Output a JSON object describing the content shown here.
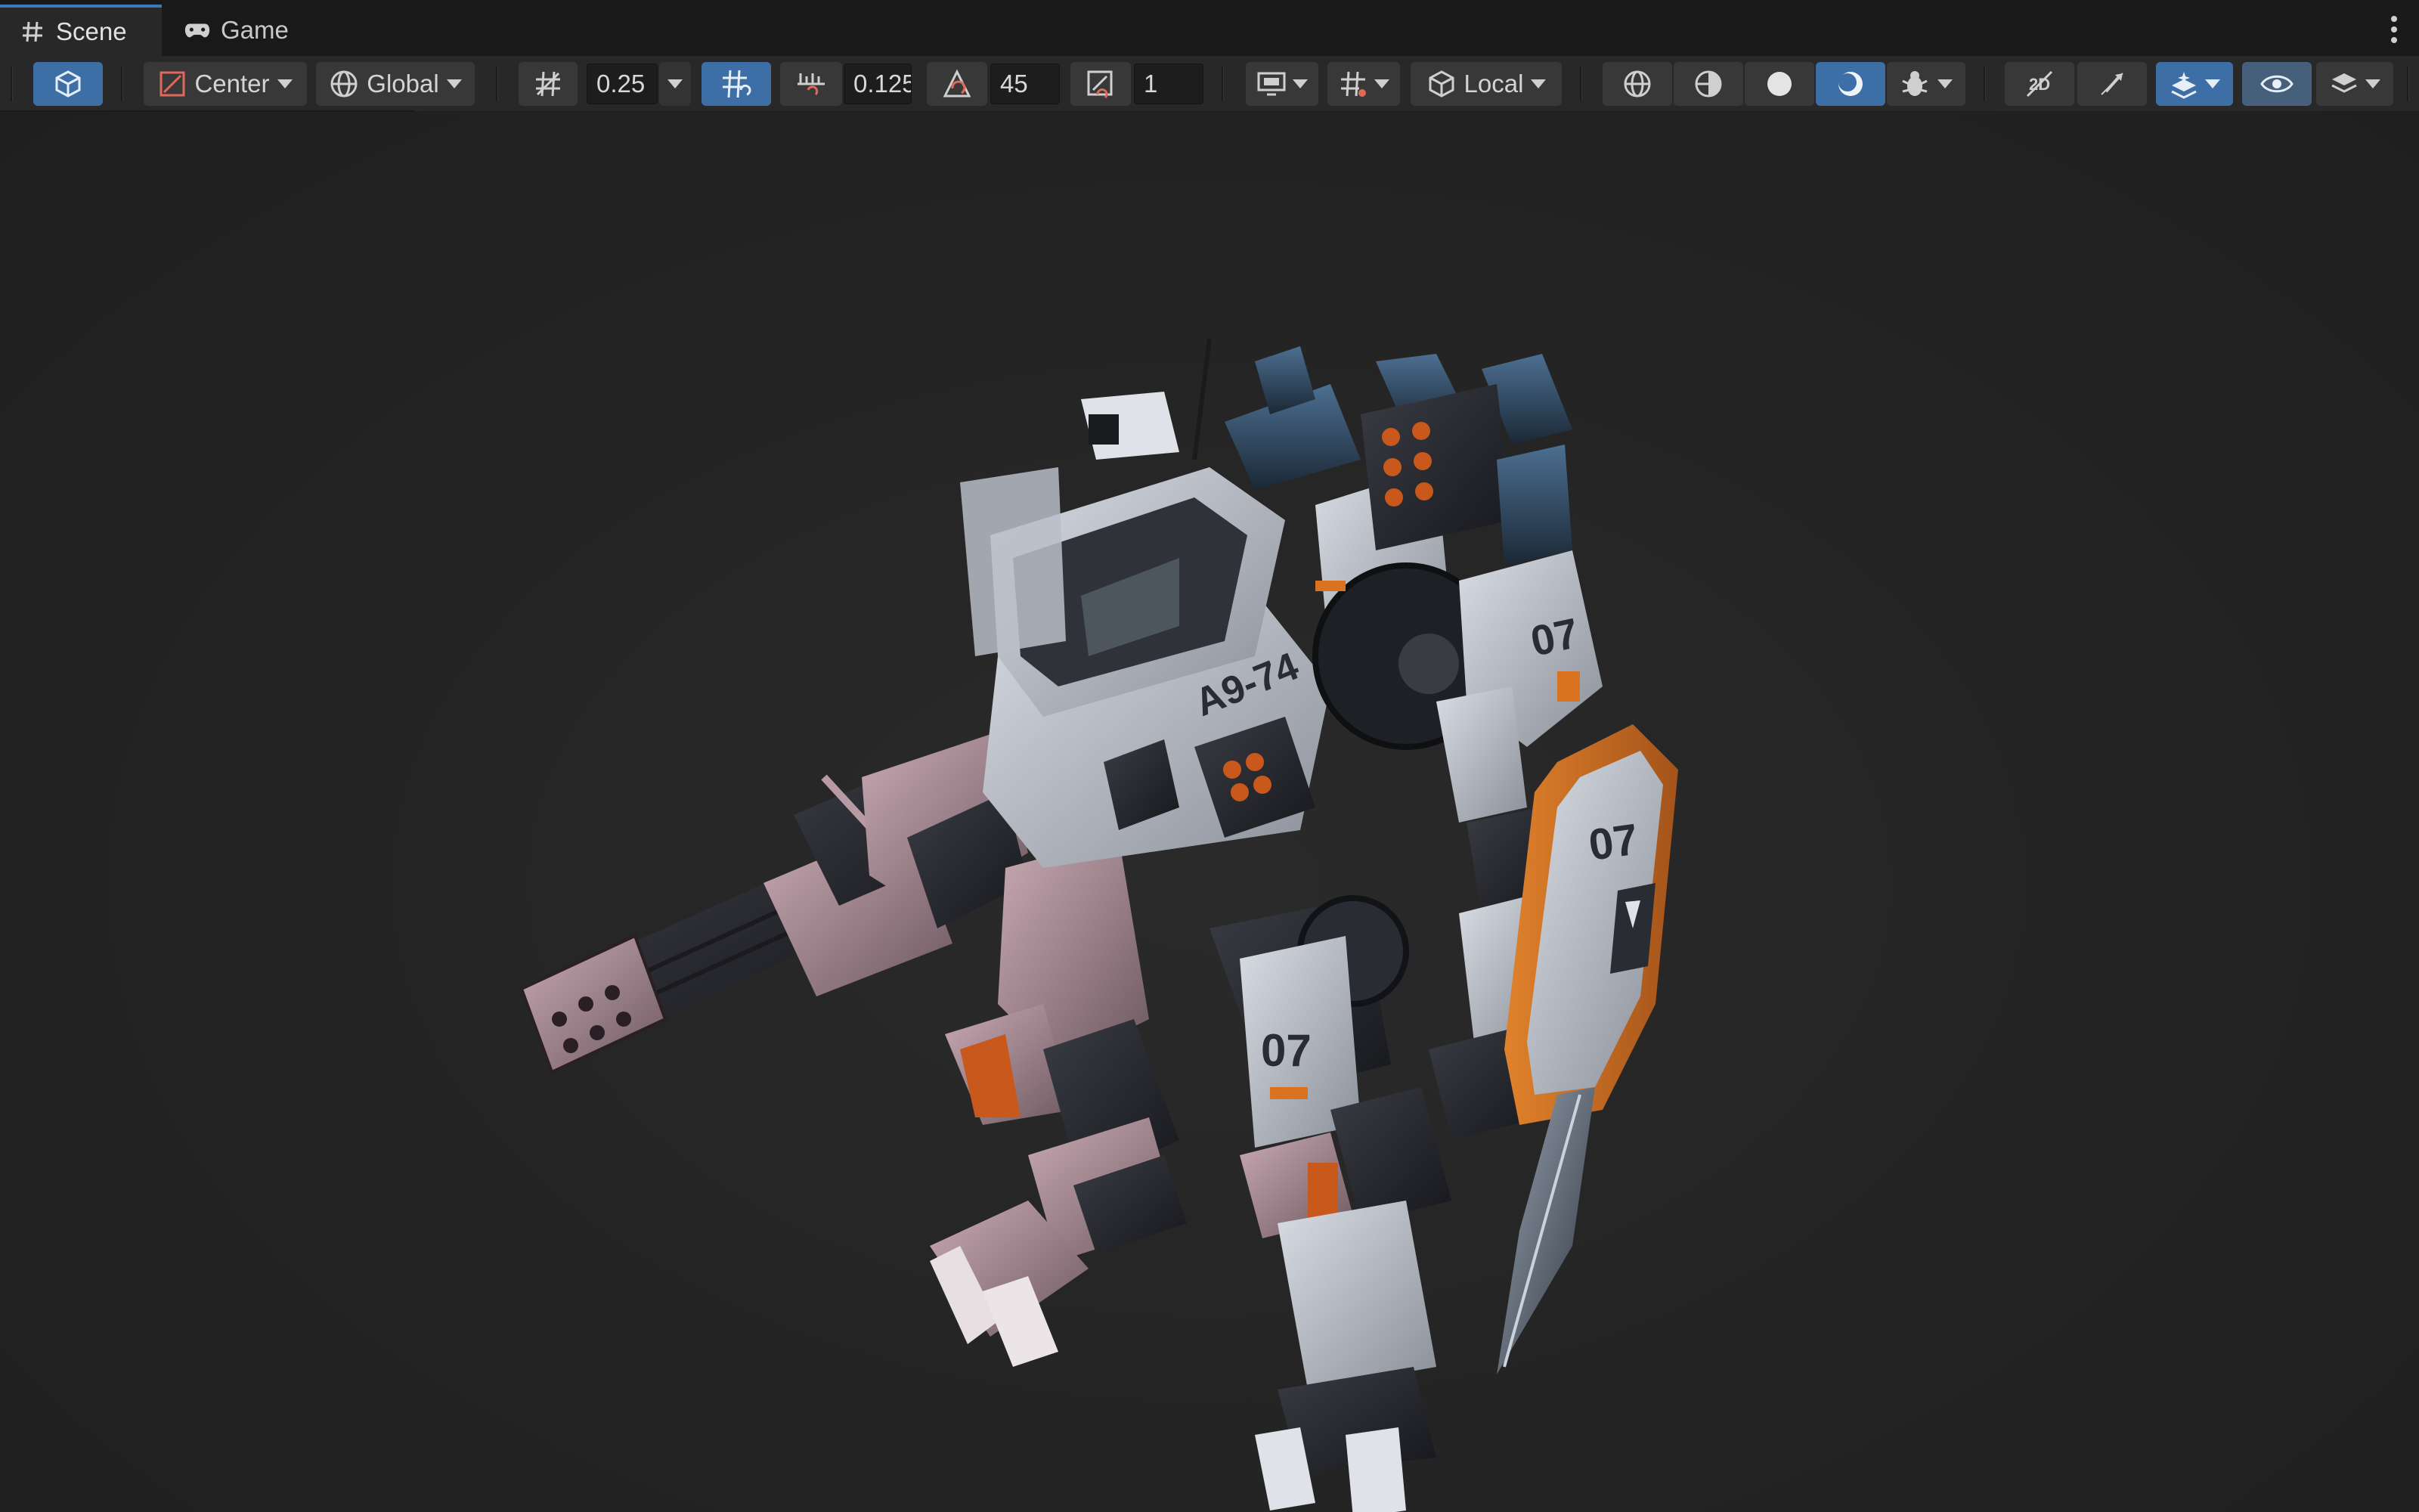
{
  "tabs": [
    {
      "label": "Scene",
      "icon": "grid-hash-icon",
      "active": true
    },
    {
      "label": "Game",
      "icon": "gamepad-icon",
      "active": false
    }
  ],
  "toolbar": {
    "pivot": {
      "label": "Center",
      "icon": "pivot-center-icon"
    },
    "space": {
      "label": "Global",
      "icon": "globe-icon"
    },
    "grid_size": "0.25",
    "increment_snap": "0.125",
    "rotation_snap": "45",
    "scale_snap": "1",
    "handle_space": {
      "label": "Local",
      "icon": "cube-local-icon"
    }
  },
  "scene": {
    "decal_texts": [
      "A9-74",
      "07",
      "07",
      "07"
    ]
  },
  "colors": {
    "accent_blue": "#3d6ea6",
    "tab_underline": "#3a79bb",
    "mech_orange": "#d9731f",
    "viewport_bg": "#232323"
  }
}
